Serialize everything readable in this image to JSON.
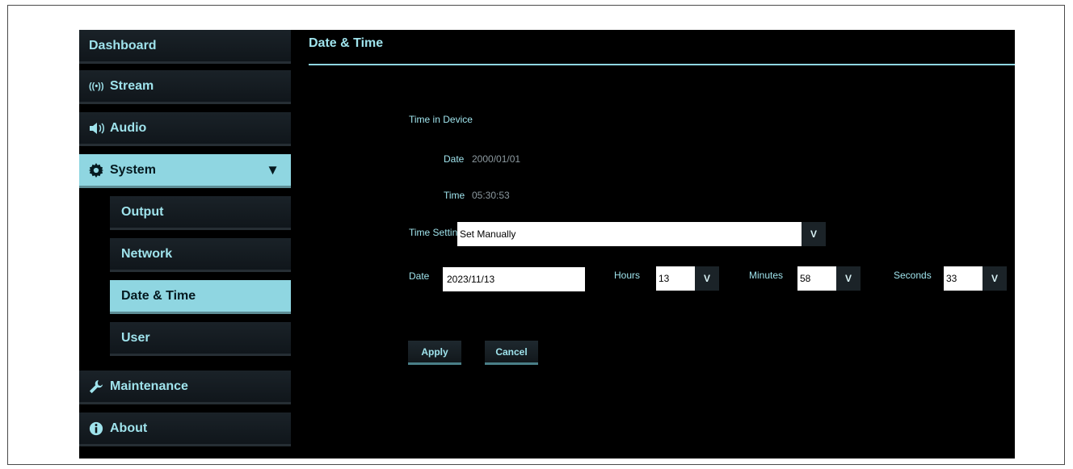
{
  "sidebar": {
    "items": [
      {
        "label": "Dashboard",
        "icon": ""
      },
      {
        "label": "Stream",
        "icon": "wireless-broadcast-icon"
      },
      {
        "label": "Audio",
        "icon": "speaker-icon"
      },
      {
        "label": "System",
        "icon": "gear-icon",
        "expanded": true
      },
      {
        "label": "Maintenance",
        "icon": "wrench-icon"
      },
      {
        "label": "About",
        "icon": "info-icon"
      }
    ],
    "sub_items": [
      {
        "label": "Output"
      },
      {
        "label": "Network"
      },
      {
        "label": "Date & Time",
        "active": true
      },
      {
        "label": "User"
      }
    ]
  },
  "main": {
    "title": "Date & Time",
    "device": {
      "heading": "Time in Device",
      "date_label": "Date",
      "date_value": "2000/01/01",
      "time_label": "Time",
      "time_value": "05:30:53"
    },
    "time_setting": {
      "label": "Time Setting",
      "value": "Set Manually"
    },
    "manual": {
      "date_label": "Date",
      "date_value": "2023/11/13",
      "hours_label": "Hours",
      "hours_value": "13",
      "minutes_label": "Minutes",
      "minutes_value": "58",
      "seconds_label": "Seconds",
      "seconds_value": "33"
    },
    "buttons": {
      "apply": "Apply",
      "cancel": "Cancel"
    }
  },
  "colors": {
    "accent": "#8fd6e1",
    "text_accent": "#9fe3ec",
    "background": "#000000"
  }
}
